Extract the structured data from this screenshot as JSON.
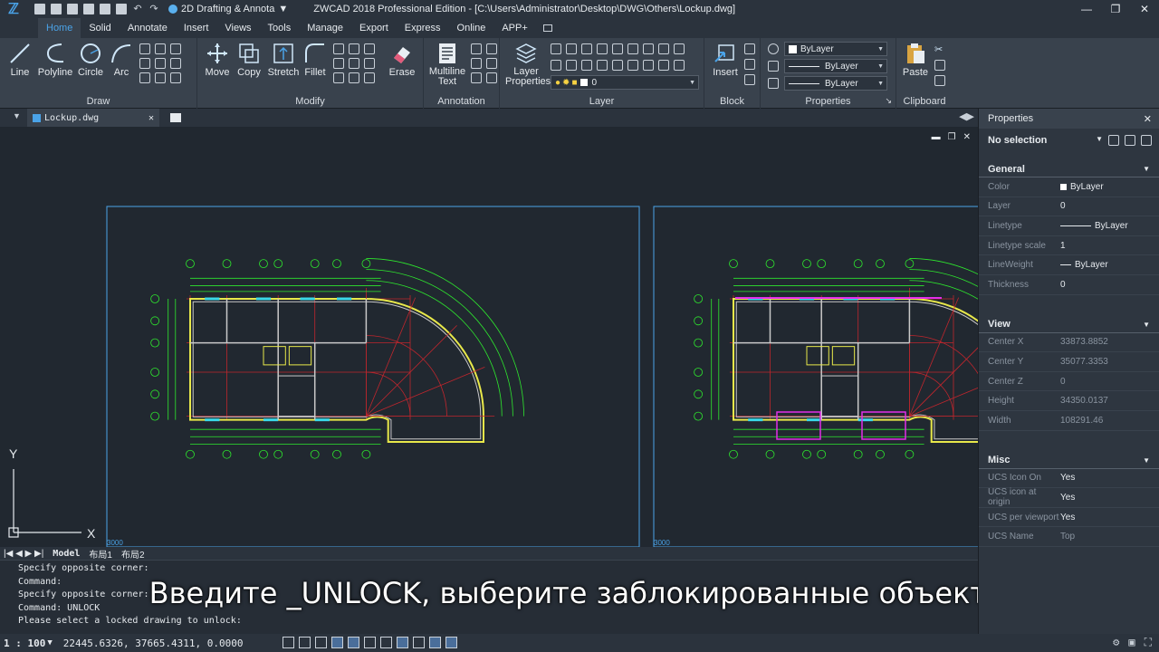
{
  "titlebar": {
    "workspace": "2D Drafting & Annota",
    "title": "ZWCAD 2018 Professional Edition - [C:\\Users\\Administrator\\Desktop\\DWG\\Others\\Lockup.dwg]",
    "minimize": "—",
    "restore": "❐",
    "close": "✕"
  },
  "tabs": [
    {
      "label": "Home"
    },
    {
      "label": "Solid"
    },
    {
      "label": "Annotate"
    },
    {
      "label": "Insert"
    },
    {
      "label": "Views"
    },
    {
      "label": "Tools"
    },
    {
      "label": "Manage"
    },
    {
      "label": "Export"
    },
    {
      "label": "Express"
    },
    {
      "label": "Online"
    },
    {
      "label": "APP+"
    }
  ],
  "ribbon": {
    "draw": {
      "label": "Draw",
      "line": "Line",
      "polyline": "Polyline",
      "circle": "Circle",
      "arc": "Arc"
    },
    "modify": {
      "label": "Modify",
      "move": "Move",
      "copy": "Copy",
      "stretch": "Stretch",
      "fillet": "Fillet",
      "erase": "Erase"
    },
    "annotation": {
      "label": "Annotation",
      "mtext": "Multiline Text"
    },
    "layer": {
      "label": "Layer",
      "props": "Layer Properties",
      "current": "0"
    },
    "block": {
      "label": "Block",
      "insert": "Insert"
    },
    "properties": {
      "label": "Properties",
      "color": "ByLayer",
      "linetype": "ByLayer",
      "lineweight": "ByLayer"
    },
    "clipboard": {
      "label": "Clipboard",
      "paste": "Paste"
    }
  },
  "doc": {
    "tab": "Lockup.dwg",
    "close": "✕"
  },
  "layouts": {
    "model": "Model",
    "l1": "布局1",
    "l2": "布局2"
  },
  "drawing": {
    "vp_label_1": "3000",
    "vp_label_2": "3000"
  },
  "cmd": {
    "lines": [
      "Specify opposite corner:",
      "Command:",
      "Specify opposite corner:",
      "Command: UNLOCK",
      "Please select a locked drawing to unlock:"
    ]
  },
  "subtitle": "Введите _UNLOCK, выберите заблокированные объекты",
  "status": {
    "scale": "1 : 100",
    "coords": "22445.6326, 37665.4311, 0.0000"
  },
  "props": {
    "title": "Properties",
    "selection": "No selection",
    "general": {
      "title": "General",
      "rows": [
        {
          "k": "Color",
          "v": "ByLayer"
        },
        {
          "k": "Layer",
          "v": "0"
        },
        {
          "k": "Linetype",
          "v": "ByLayer"
        },
        {
          "k": "Linetype scale",
          "v": "1"
        },
        {
          "k": "LineWeight",
          "v": "ByLayer"
        },
        {
          "k": "Thickness",
          "v": "0"
        }
      ]
    },
    "view": {
      "title": "View",
      "rows": [
        {
          "k": "Center X",
          "v": "33873.8852"
        },
        {
          "k": "Center Y",
          "v": "35077.3353"
        },
        {
          "k": "Center Z",
          "v": "0"
        },
        {
          "k": "Height",
          "v": "34350.0137"
        },
        {
          "k": "Width",
          "v": "108291.46"
        }
      ]
    },
    "misc": {
      "title": "Misc",
      "rows": [
        {
          "k": "UCS Icon On",
          "v": "Yes"
        },
        {
          "k": "UCS icon at origin",
          "v": "Yes"
        },
        {
          "k": "UCS per viewport",
          "v": "Yes"
        },
        {
          "k": "UCS Name",
          "v": "Top"
        }
      ]
    }
  },
  "colors": {
    "accent": "#4aa3e8",
    "grid_red": "#c0262d",
    "green": "#2ee82e",
    "yellow": "#e8e84a",
    "cyan": "#3ad8e8",
    "magenta": "#e22ee8"
  }
}
